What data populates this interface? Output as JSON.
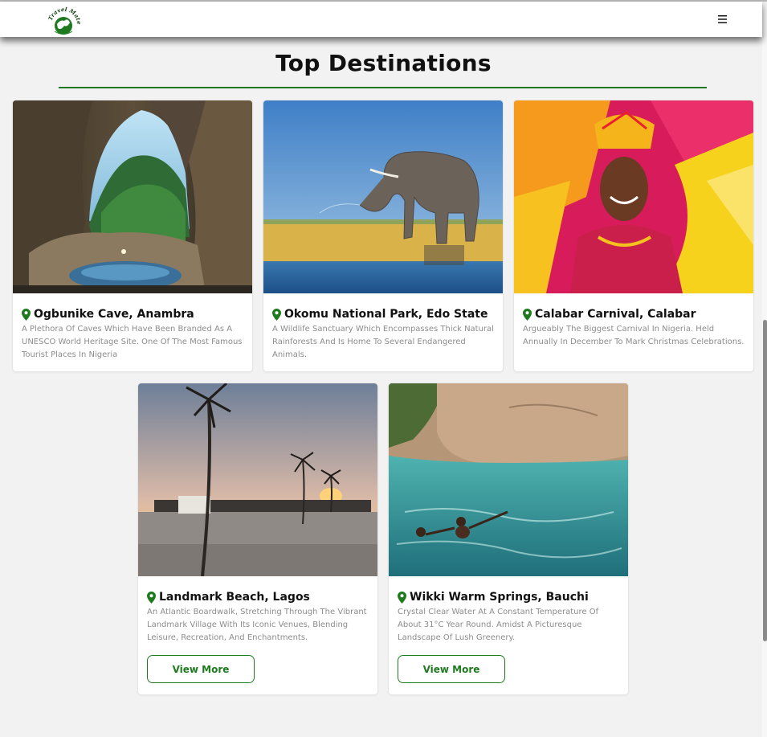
{
  "header": {
    "logo_text": "Travel Mate",
    "menu_icon": "hamburger-menu-icon"
  },
  "section": {
    "title": "Top Destinations"
  },
  "colors": {
    "accent": "#1f7a1f",
    "title_text": "#111111",
    "description_text": "#8c8c8c",
    "background": "#f2f2f2"
  },
  "destinations": [
    {
      "name": "Ogbunike Cave, Anambra",
      "description": "A Plethora Of Caves Which Have Been Branded As A UNESCO World Heritage Site. One Of The Most Famous Tourist Places In Nigeria",
      "image": "cave-photo"
    },
    {
      "name": "Okomu National Park, Edo State",
      "description": "A Wildlife Sanctuary Which Encompasses Thick Natural Rainforests And Is Home To Several Endangered Animals.",
      "image": "elephant-photo"
    },
    {
      "name": "Calabar Carnival, Calabar",
      "description": "Argueably The Biggest Carnival In Nigeria. Held Annually In December To Mark Christmas Celebrations.",
      "image": "carnival-photo"
    },
    {
      "name": "Landmark Beach, Lagos",
      "description": "An Atlantic Boardwalk, Stretching Through The Vibrant Landmark Village With Its Iconic Venues, Blending Leisure, Recreation, And Enchantments.",
      "image": "beach-photo",
      "button_label": "View More"
    },
    {
      "name": "Wikki Warm Springs, Bauchi",
      "description": "Crystal Clear Water At A Constant Temperature Of About 31°C Year Round. Amidst A Picturesque Landscape Of Lush Greenery.",
      "image": "springs-photo",
      "button_label": "View More"
    }
  ]
}
